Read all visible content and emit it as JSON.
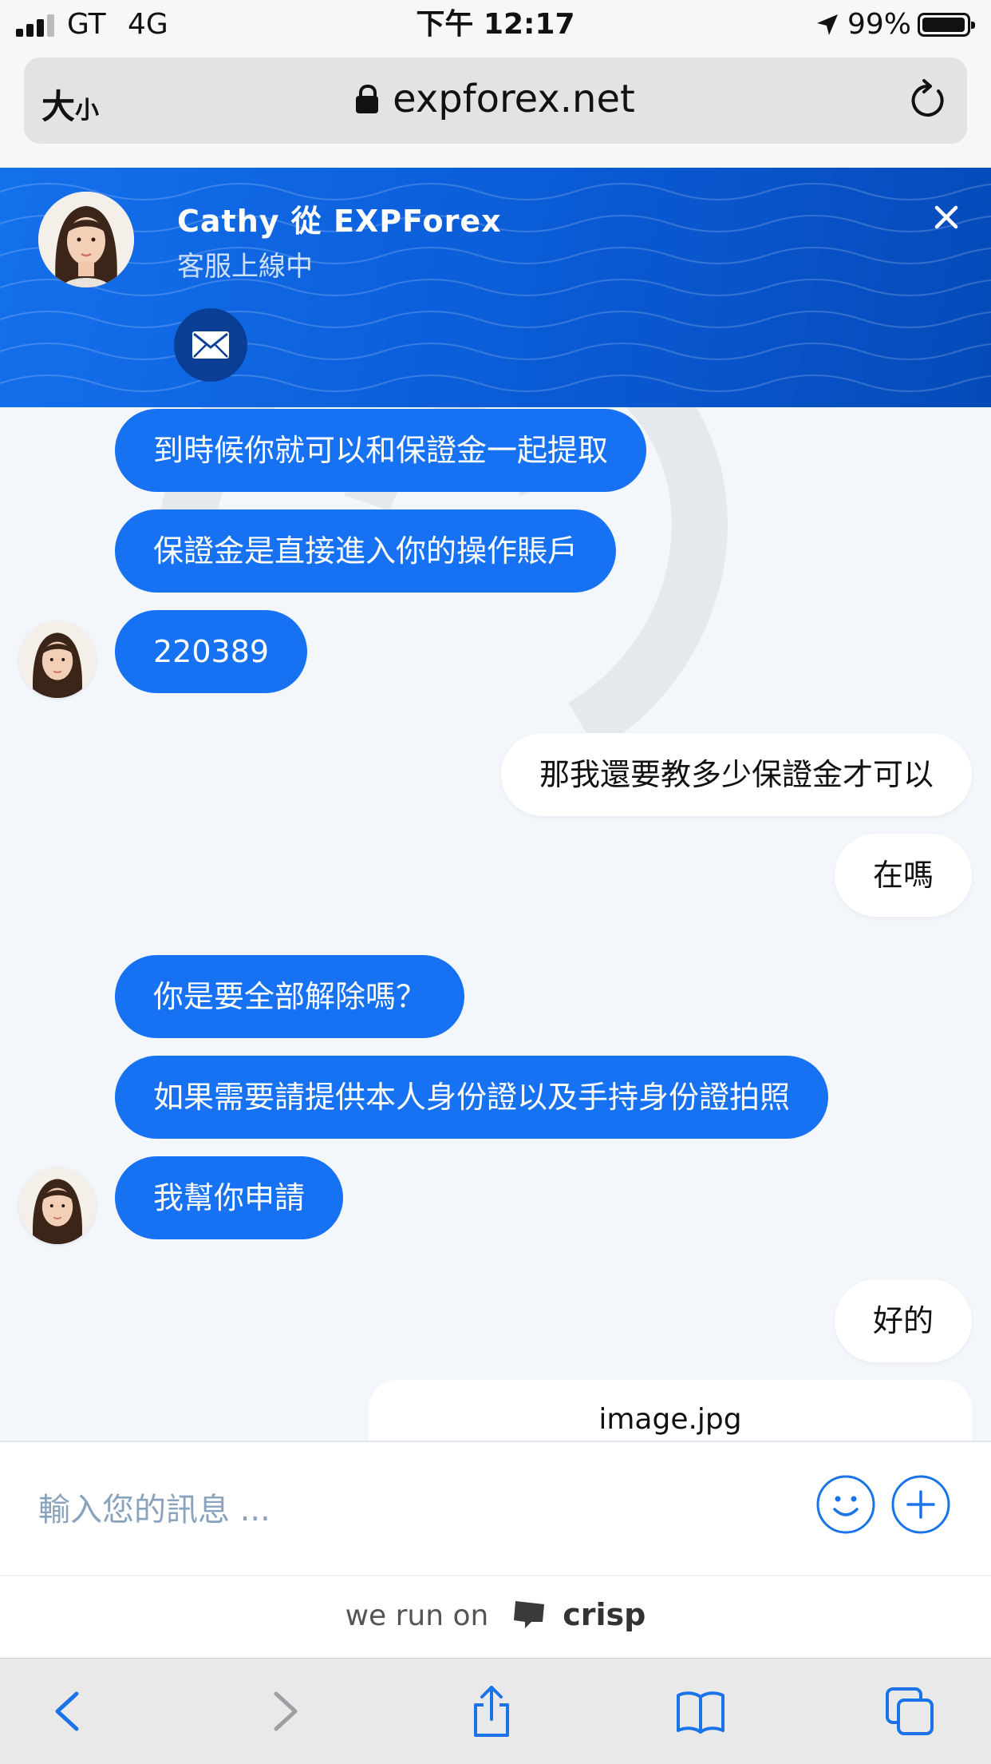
{
  "status_bar": {
    "carrier": "GT",
    "network": "4G",
    "time": "下午 12:17",
    "battery_percent": "99%",
    "battery_level": 0.99
  },
  "address_bar": {
    "text_size_label_large": "大",
    "text_size_label_small": "小",
    "url": "expforex.net"
  },
  "chat_header": {
    "agent_name": "Cathy 從 EXPForex",
    "agent_status": "客服上線中"
  },
  "messages": [
    {
      "from": "operator",
      "text": "到時候你就可以和保證金一起提取"
    },
    {
      "from": "operator",
      "text": "保證金是直接進入你的操作賬戶"
    },
    {
      "from": "operator",
      "text": "220389"
    },
    {
      "from": "user",
      "text": "那我還要教多少保證金才可以"
    },
    {
      "from": "user",
      "text": "在嗎"
    },
    {
      "from": "operator",
      "text": "你是要全部解除嗎？"
    },
    {
      "from": "operator",
      "text": "如果需要請提供本人身份證以及手持身份證拍照"
    },
    {
      "from": "operator",
      "text": "我幫你申請"
    },
    {
      "from": "user",
      "text": "好的"
    }
  ],
  "file_attachment": {
    "filename": "image.jpg"
  },
  "composer": {
    "placeholder": "輸入您的訊息 ..."
  },
  "branding": {
    "prefix": "we run on",
    "brand": "crisp"
  },
  "colors": {
    "header_blue": "#0a5bd6",
    "operator_bubble": "#1672f3",
    "user_bubble": "#ffffff",
    "chat_background": "#f3f6fb",
    "icon_blue": "#1a73e8"
  },
  "toolbar": {
    "icons": [
      "back-icon",
      "forward-icon",
      "share-icon",
      "bookmarks-icon",
      "tabs-icon"
    ]
  }
}
